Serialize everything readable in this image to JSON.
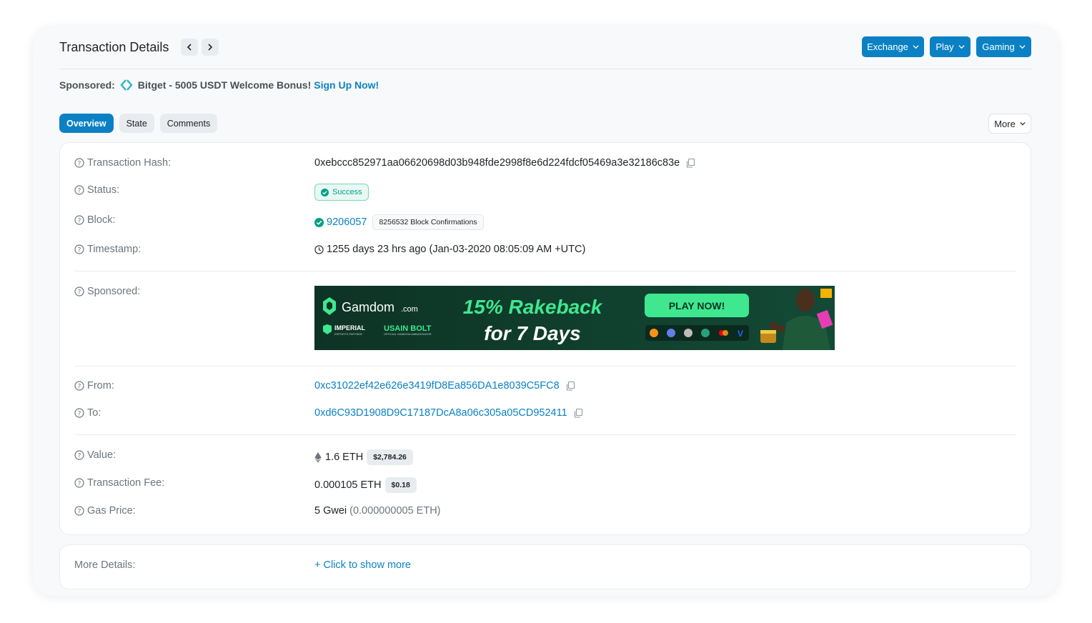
{
  "header": {
    "title": "Transaction Details",
    "buttons": [
      {
        "label": "Exchange"
      },
      {
        "label": "Play"
      },
      {
        "label": "Gaming"
      }
    ]
  },
  "sponsored_line": {
    "prefix": "Sponsored:",
    "text": "Bitget - 5005 USDT Welcome Bonus!",
    "link": "Sign Up Now!"
  },
  "tabs": [
    {
      "label": "Overview",
      "active": true
    },
    {
      "label": "State",
      "active": false
    },
    {
      "label": "Comments",
      "active": false
    }
  ],
  "more_button": "More",
  "details": {
    "hash": {
      "label": "Transaction Hash:",
      "value": "0xebccc852971aa06620698d03b948fde2998f8e6d224fdcf05469a3e32186c83e"
    },
    "status": {
      "label": "Status:",
      "value": "Success"
    },
    "block": {
      "label": "Block:",
      "value": "9206057",
      "confirmations": "8256532 Block Confirmations"
    },
    "timestamp": {
      "label": "Timestamp:",
      "value": "1255 days 23 hrs ago (Jan-03-2020 08:05:09 AM +UTC)"
    },
    "sponsored": {
      "label": "Sponsored:"
    },
    "from": {
      "label": "From:",
      "value": "0xc31022ef42e626e3419fD8Ea856DA1e8039C5FC8"
    },
    "to": {
      "label": "To:",
      "value": "0xd6C93D1908D9C17187DcA8a06c305a05CD952411"
    },
    "value": {
      "label": "Value:",
      "value": "1.6 ETH",
      "usd": "$2,784.26"
    },
    "fee": {
      "label": "Transaction Fee:",
      "value": "0.000105 ETH",
      "usd": "$0.18"
    },
    "gas": {
      "label": "Gas Price:",
      "value": "5 Gwei",
      "eth": "(0.000000005 ETH)"
    }
  },
  "banner": {
    "brand": "Gamdom",
    "brand_suffix": ".com",
    "partner1": "IMPERIAL",
    "partner1_sub": "ESPORTS PARTNER",
    "partner2": "USAIN BOLT",
    "partner2_sub": "OFFICIAL GAMDOM AMBASSADOR",
    "headline1": "15% Rakeback",
    "headline2": "for 7 Days",
    "cta": "PLAY NOW!"
  },
  "more_details": {
    "label": "More Details:",
    "link": "+ Click to show more"
  },
  "colors": {
    "accent": "#0b81c4",
    "success": "#00a186",
    "banner_bg": "#0f3a2b",
    "banner_green": "#3fe88f"
  }
}
